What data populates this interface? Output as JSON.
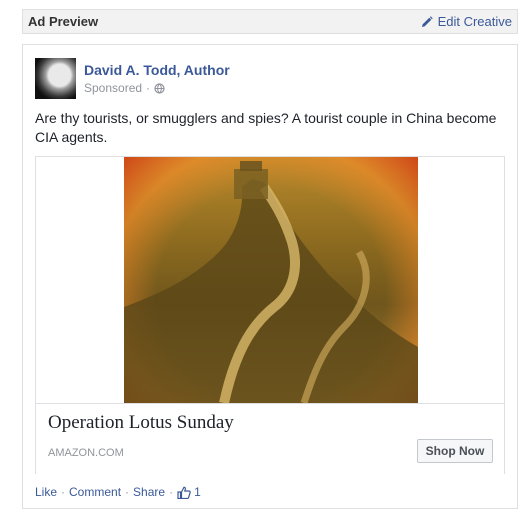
{
  "header": {
    "title": "Ad Preview",
    "edit_label": "Edit Creative",
    "edit_icon": "pencil-icon"
  },
  "post": {
    "author": "David A. Todd, Author",
    "sponsored": "Sponsored",
    "sponsored_sep": "·",
    "privacy_icon": "globe-icon",
    "text": "Are thy tourists, or smugglers and spies? A tourist couple in China become CIA agents."
  },
  "ad": {
    "image": "great-wall-photo",
    "title": "Operation Lotus Sunday",
    "domain": "AMAZON.COM",
    "cta": "Shop Now"
  },
  "actions": {
    "like": "Like",
    "comment": "Comment",
    "share": "Share",
    "sep": "·",
    "like_icon": "thumbs-up-icon",
    "like_count": "1"
  },
  "colors": {
    "link": "#3b5998",
    "muted": "#90949c",
    "border": "#dddfe2"
  }
}
